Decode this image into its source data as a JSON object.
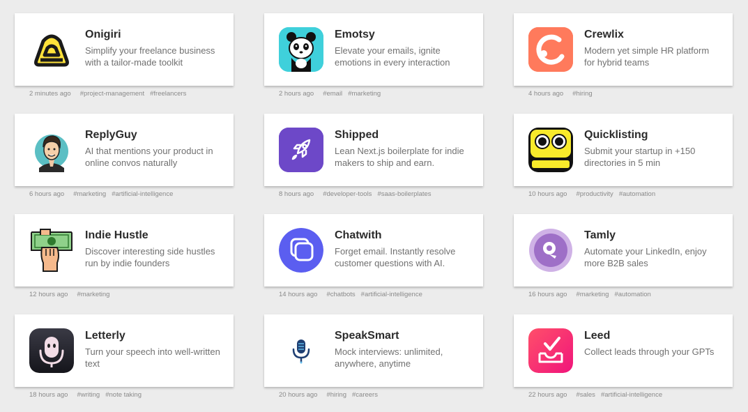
{
  "cards": [
    {
      "name": "Onigiri",
      "desc": "Simplify your freelance business with a tailor-made toolkit",
      "time": "2 minutes ago",
      "tags": [
        "#project-management",
        "#freelancers"
      ],
      "logo": "onigiri-logo-icon"
    },
    {
      "name": "Emotsy",
      "desc": "Elevate your emails, ignite emotions in every interaction",
      "time": "2 hours ago",
      "tags": [
        "#email",
        "#marketing"
      ],
      "logo": "panda-logo-icon"
    },
    {
      "name": "Crewlix",
      "desc": "Modern yet simple HR platform for hybrid teams",
      "time": "4 hours ago",
      "tags": [
        "#hiring"
      ],
      "logo": "crewlix-logo-icon"
    },
    {
      "name": "ReplyGuy",
      "desc": "AI that mentions your product in online convos naturally",
      "time": "6 hours ago",
      "tags": [
        "#marketing",
        "#artificial-intelligence"
      ],
      "logo": "man-avatar-logo-icon"
    },
    {
      "name": "Shipped",
      "desc": "Lean Next.js boilerplate for indie makers to ship and earn.",
      "time": "8 hours ago",
      "tags": [
        "#developer-tools",
        "#saas-boilerplates"
      ],
      "logo": "rocket-logo-icon"
    },
    {
      "name": "Quicklisting",
      "desc": "Submit your startup in +150 directories in 5 min",
      "time": "10 hours ago",
      "tags": [
        "#productivity",
        "#automation"
      ],
      "logo": "robot-face-logo-icon"
    },
    {
      "name": "Indie Hustle",
      "desc": "Discover interesting side hustles run by indie founders",
      "time": "12 hours ago",
      "tags": [
        "#marketing"
      ],
      "logo": "hand-cash-logo-icon"
    },
    {
      "name": "Chatwith",
      "desc": "Forget email. Instantly resolve customer questions with AI.",
      "time": "14 hours ago",
      "tags": [
        "#chatbots",
        "#artificial-intelligence"
      ],
      "logo": "chatwith-logo-icon"
    },
    {
      "name": "Tamly",
      "desc": "Automate your LinkedIn, enjoy more B2B sales",
      "time": "16 hours ago",
      "tags": [
        "#marketing",
        "#automation"
      ],
      "logo": "tamly-logo-icon"
    },
    {
      "name": "Letterly",
      "desc": "Turn your speech into well-written text",
      "time": "18 hours ago",
      "tags": [
        "#writing",
        "#note taking"
      ],
      "logo": "letterly-logo-icon"
    },
    {
      "name": "SpeakSmart",
      "desc": "Mock interviews: unlimited, anywhere, anytime",
      "time": "20 hours ago",
      "tags": [
        "#hiring",
        "#careers"
      ],
      "logo": "microphone-logo-icon"
    },
    {
      "name": "Leed",
      "desc": "Collect leads through your GPTs",
      "time": "22 hours ago",
      "tags": [
        "#sales",
        "#artificial-intelligence"
      ],
      "logo": "leed-logo-icon"
    }
  ],
  "colors": {
    "background": "#ececec",
    "card": "#ffffff",
    "title": "#2b2b2b",
    "description": "#707070",
    "meta": "#8a8a8a"
  }
}
